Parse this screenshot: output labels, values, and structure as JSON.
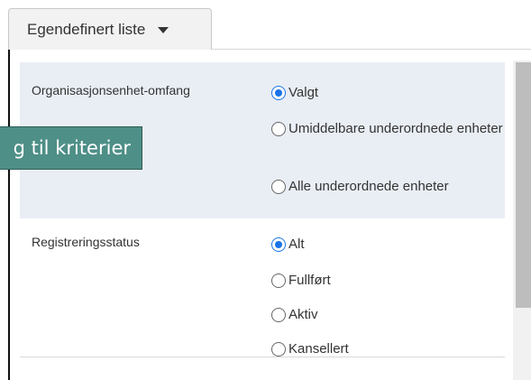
{
  "header": {
    "dropdown_label": "Egendefinert liste"
  },
  "criteria": {
    "org_scope": {
      "label": "Organisasjonsenhet-omfang",
      "options": [
        {
          "label": "Valgt",
          "selected": true
        },
        {
          "label": "Umiddelbare underordnede enheter",
          "selected": false
        },
        {
          "label": "Alle underordnede enheter",
          "selected": false
        }
      ]
    },
    "registration_status": {
      "label": "Registreringsstatus",
      "options": [
        {
          "label": "Alt",
          "selected": true
        },
        {
          "label": "Fullført",
          "selected": false
        },
        {
          "label": "Aktiv",
          "selected": false
        },
        {
          "label": "Kansellert",
          "selected": false
        }
      ]
    }
  },
  "callout": {
    "text": "g til kriterier"
  },
  "colors": {
    "accent": "#1a73e8",
    "shaded_row": "#e9eef5",
    "callout_bg": "#4e8f87"
  }
}
